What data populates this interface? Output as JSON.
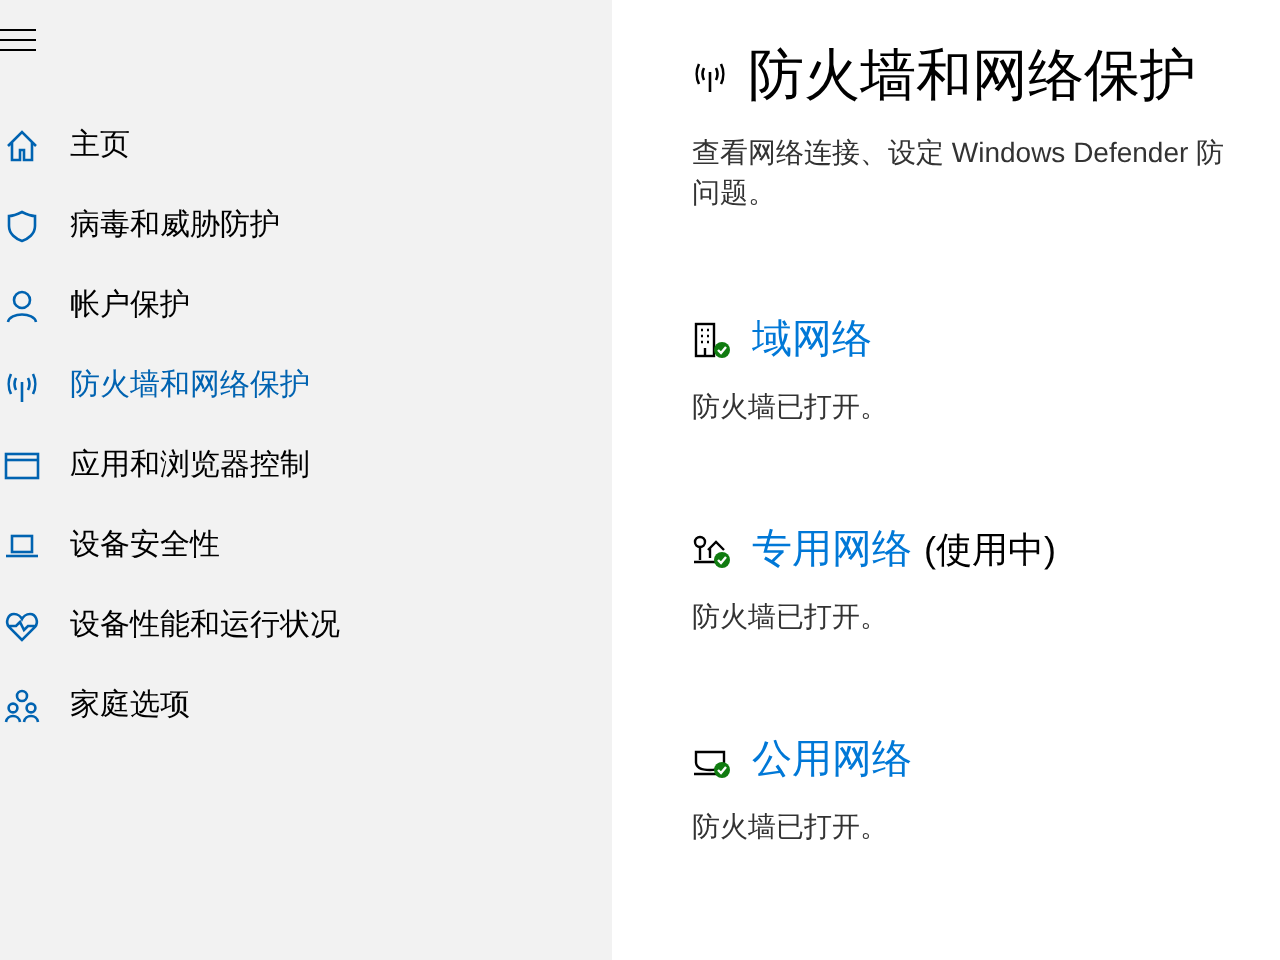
{
  "sidebar": {
    "items": [
      {
        "label": "主页",
        "kind": "home",
        "selected": false
      },
      {
        "label": "病毒和威胁防护",
        "kind": "shield",
        "selected": false
      },
      {
        "label": "帐户保护",
        "kind": "person",
        "selected": false
      },
      {
        "label": "防火墙和网络保护",
        "kind": "antenna",
        "selected": true
      },
      {
        "label": "应用和浏览器控制",
        "kind": "window",
        "selected": false
      },
      {
        "label": "设备安全性",
        "kind": "laptop",
        "selected": false
      },
      {
        "label": "设备性能和运行状况",
        "kind": "heart",
        "selected": false
      },
      {
        "label": "家庭选项",
        "kind": "family",
        "selected": false
      }
    ]
  },
  "page": {
    "title": "防火墙和网络保护",
    "description_lines": [
      "查看网络连接、设定 Windows Defender 防",
      "问题。"
    ]
  },
  "networks": [
    {
      "kind": "domain",
      "name": "域网络",
      "status": "防火墙已打开。"
    },
    {
      "kind": "private",
      "name": "专用网络",
      "badge": "(使用中)",
      "status": "防火墙已打开。"
    },
    {
      "kind": "public",
      "name": "公用网络",
      "status": "防火墙已打开。"
    }
  ]
}
